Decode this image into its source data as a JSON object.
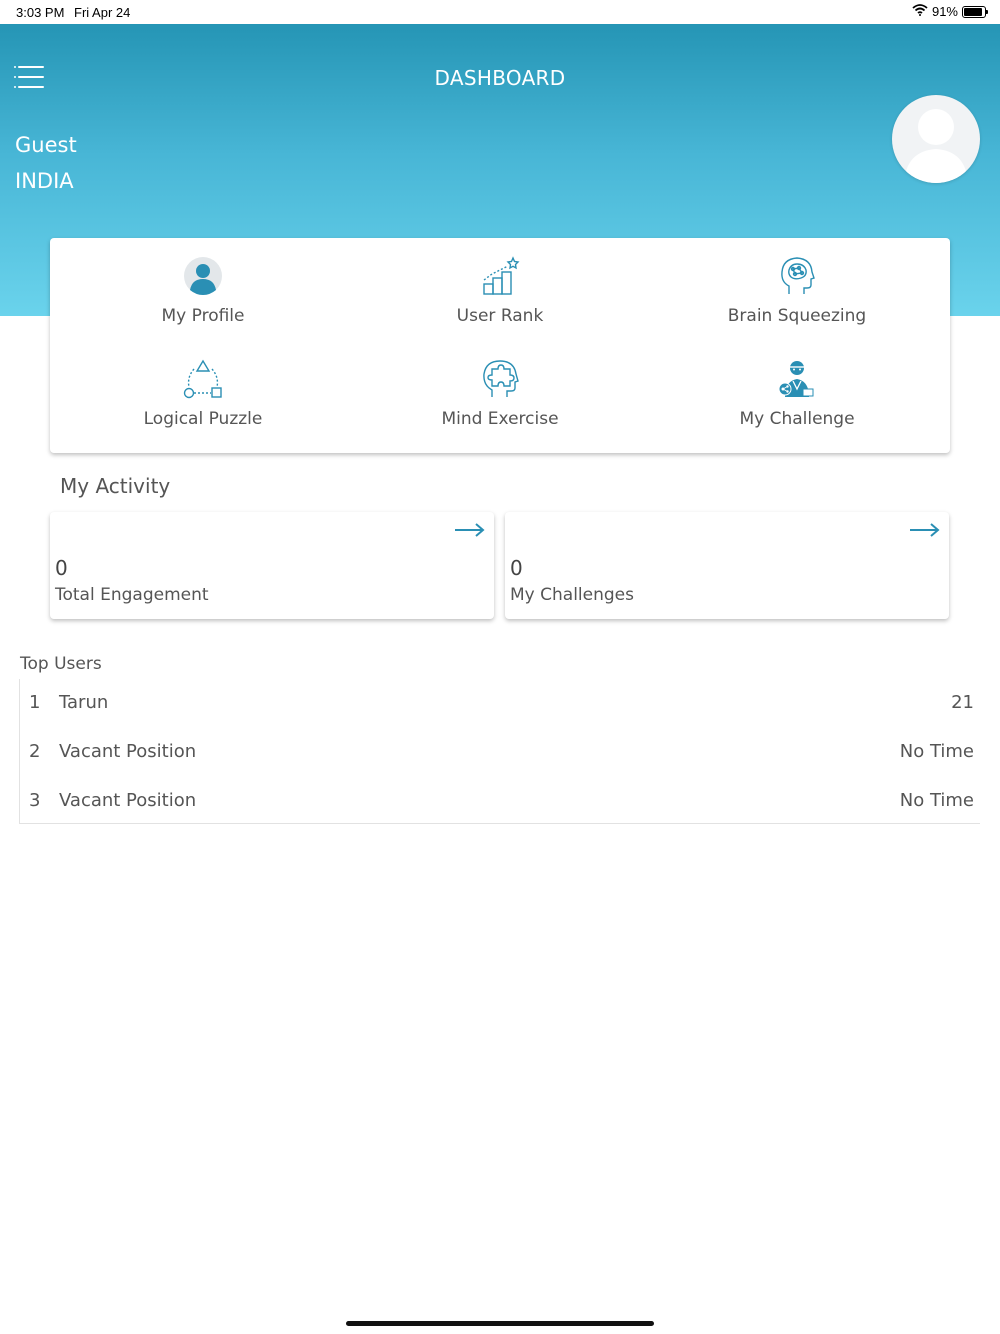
{
  "status": {
    "time": "3:03 PM",
    "date": "Fri Apr 24",
    "battery": "91%",
    "battery_level": 0.91
  },
  "header": {
    "title": "DASHBOARD",
    "user_name": "Guest",
    "country": "INDIA"
  },
  "menu": [
    {
      "label": "My  Profile",
      "icon": "user-icon"
    },
    {
      "label": "User  Rank",
      "icon": "rank-chart-icon"
    },
    {
      "label": "Brain  Squeezing",
      "icon": "brain-head-icon"
    },
    {
      "label": "Logical  Puzzle",
      "icon": "shapes-icon"
    },
    {
      "label": "Mind  Exercise",
      "icon": "puzzle-head-icon"
    },
    {
      "label": "My  Challenge",
      "icon": "challenge-person-icon"
    }
  ],
  "activity": {
    "title": "My  Activity",
    "cards": [
      {
        "count": "0",
        "label": "Total  Engagement"
      },
      {
        "count": "0",
        "label": "My  Challenges"
      }
    ]
  },
  "top_users": {
    "title": "Top  Users",
    "rows": [
      {
        "rank": "1",
        "name": "Tarun",
        "value": "21"
      },
      {
        "rank": "2",
        "name": "Vacant  Position",
        "value": "No  Time"
      },
      {
        "rank": "3",
        "name": "Vacant  Position",
        "value": "No  Time"
      }
    ]
  },
  "colors": {
    "accent": "#2a8fb4",
    "header_top": "#2595b5",
    "header_bottom": "#6ad3ec"
  }
}
